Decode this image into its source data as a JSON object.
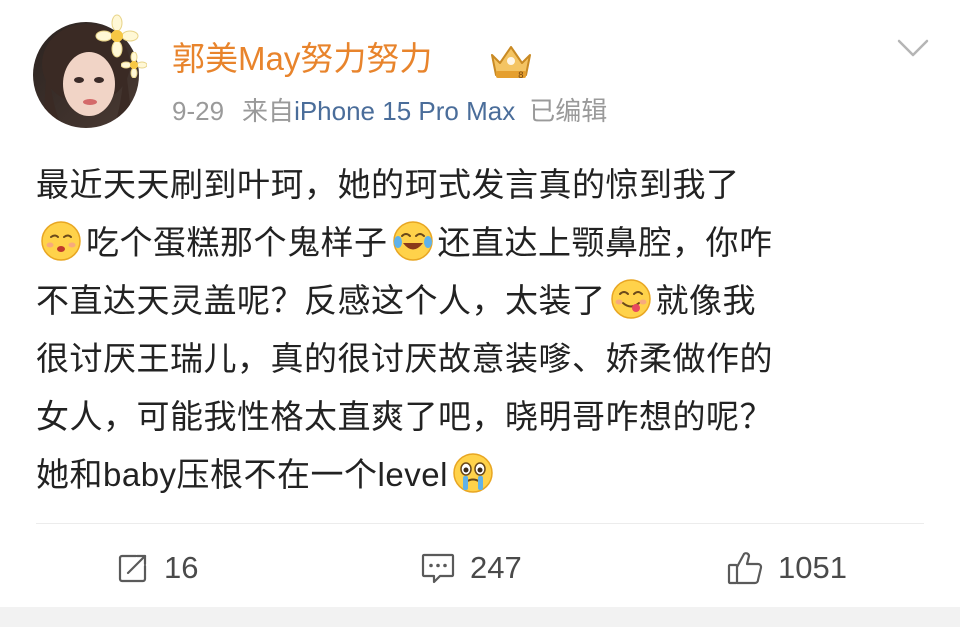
{
  "post": {
    "username": "郭美May努力努力",
    "date": "9-29",
    "source_prefix": "来自",
    "device": "iPhone 15 Pro Max",
    "edited": "已编辑",
    "content": {
      "line1": "最近天天刷到叶珂，她的珂式发言真的惊到我了",
      "line2_a": "吃个蛋糕那个鬼样子",
      "line2_b": "还直达上颚鼻腔，你咋",
      "line3_a": "不直达天灵盖呢？反感这个人，太装了",
      "line3_b": "就像我",
      "line4": "很讨厌王瑞儿，真的很讨厌故意装嗲、娇柔做作的",
      "line5": "女人，可能我性格太直爽了吧，晓明哥咋想的呢？",
      "line6": "她和baby压根不在一个level"
    },
    "emojis": [
      "smirk-face-emoji",
      "laugh-tears-emoji",
      "yummy-face-emoji",
      "crying-face-emoji"
    ]
  },
  "actions": {
    "repost_count": "16",
    "comment_count": "247",
    "like_count": "1051"
  },
  "icons": {
    "repost": "share-icon",
    "comment": "comment-icon",
    "like": "thumbs-up-icon",
    "menu": "chevron-down-icon",
    "badge": "vip-crown-badge-icon"
  },
  "colors": {
    "username": "#e8842c",
    "device": "#4a6d9a",
    "meta": "#9a9a9a",
    "text": "#222222"
  }
}
